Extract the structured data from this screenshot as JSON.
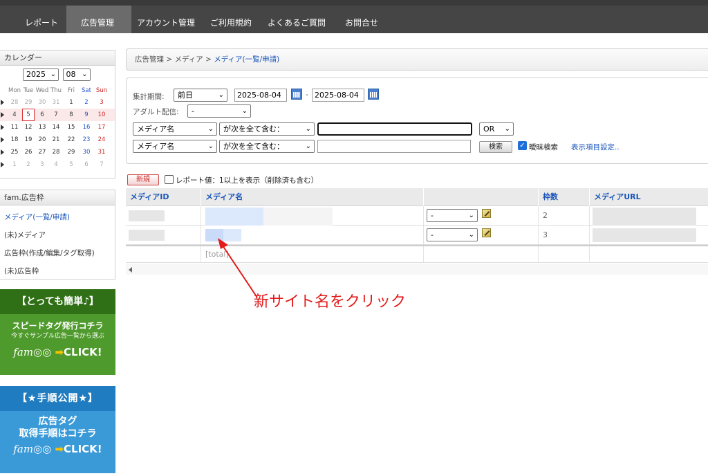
{
  "nav": {
    "items": [
      "レポート",
      "広告管理",
      "アカウント管理",
      "ご利用規約",
      "よくあるご質問",
      "お問合せ"
    ],
    "active_index": 1
  },
  "calendar": {
    "title": "カレンダー",
    "year": "2025",
    "month": "08",
    "weekdays": [
      "Mon",
      "Tue",
      "Wed",
      "Thu",
      "Fri",
      "Sat",
      "Sun"
    ],
    "weeks": [
      [
        "28",
        "29",
        "30",
        "31",
        "1",
        "2",
        "3"
      ],
      [
        "4",
        "5",
        "6",
        "7",
        "8",
        "9",
        "10"
      ],
      [
        "11",
        "12",
        "13",
        "14",
        "15",
        "16",
        "17"
      ],
      [
        "18",
        "19",
        "20",
        "21",
        "22",
        "23",
        "24"
      ],
      [
        "25",
        "26",
        "27",
        "28",
        "29",
        "30",
        "31"
      ],
      [
        "1",
        "2",
        "3",
        "4",
        "5",
        "6",
        "7"
      ]
    ],
    "today": "5"
  },
  "sidebar_menu": {
    "title": "fam.広告枠",
    "items": [
      "メディア(一覧/申請)",
      "(未)メディア",
      "広告枠(作成/編集/タグ取得)",
      "(未)広告枠"
    ]
  },
  "banners": {
    "b1": {
      "head": "【とっても簡単♪】",
      "line1": "スピードタグ発行コチラ",
      "line2": "今すぐサンプル広告一覧から選ぶ",
      "brand": "fam",
      "click": "CLICK!"
    },
    "b2": {
      "head": "【★手順公開★】",
      "line1": "広告タグ",
      "line2": "取得手順はコチラ",
      "brand": "fam",
      "click": "CLICK!"
    }
  },
  "breadcrumb": {
    "part1": "広告管理",
    "sep": ">",
    "part2": "メディア",
    "current": "メディア(一覧/申請)"
  },
  "filter": {
    "period_label": "集計期間:",
    "period_value": "前日",
    "date_from": "2025-08-04",
    "date_sep": "-",
    "date_to": "2025-08-04",
    "adult_label": "アダルト配信:",
    "adult_value": "-",
    "row1_field": "メディア名",
    "row1_cond": "が次を全て含む：",
    "row1_logic": "OR",
    "row2_field": "メディア名",
    "row2_cond": "が次を全て含む：",
    "search_button": "検索",
    "fuzzy_label": "曖昧検索",
    "column_settings_link": "表示項目設定.."
  },
  "actions": {
    "new_button": "新規",
    "report_filter_label": "レポート値：1以上を表示（削除済も含む）"
  },
  "table": {
    "columns": [
      "メディアID",
      "メディア名",
      "",
      "枠数",
      "メディアURL"
    ],
    "rows": [
      {
        "status": "-",
        "slots": "2"
      },
      {
        "status": "-",
        "slots": "3"
      }
    ],
    "total_label": "[total]"
  },
  "annotation": {
    "text": "新サイト名をクリック",
    "color": "#e31b1b"
  }
}
